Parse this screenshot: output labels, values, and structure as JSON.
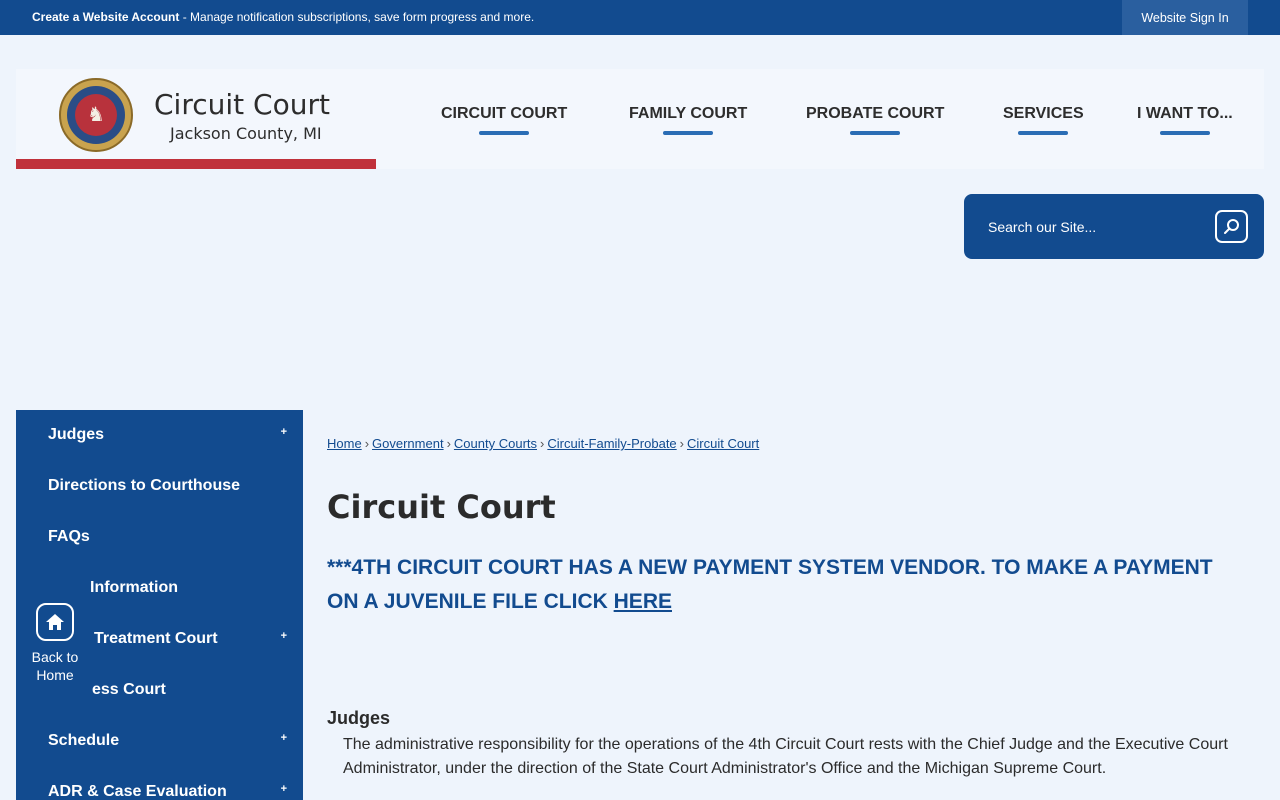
{
  "topbar": {
    "account_link": "Create a Website Account",
    "account_desc": " - Manage notification subscriptions, save form progress and more.",
    "signin": "Website Sign In"
  },
  "header": {
    "site_name": "Circuit Court",
    "site_sub": "Jackson County, MI",
    "nav": [
      {
        "label": "CIRCUIT COURT"
      },
      {
        "label": "FAMILY COURT"
      },
      {
        "label": "PROBATE COURT"
      },
      {
        "label": "SERVICES"
      },
      {
        "label": "I WANT TO..."
      }
    ]
  },
  "search": {
    "placeholder": "Search our Site..."
  },
  "sidebar": {
    "items": [
      {
        "label": "Judges",
        "expand": "+"
      },
      {
        "label": "Directions to Courthouse",
        "expand": ""
      },
      {
        "label": "FAQs",
        "expand": ""
      },
      {
        "label": "Information",
        "expand": ""
      },
      {
        "label": "Treatment Court",
        "expand": "+"
      },
      {
        "label": "ess Court",
        "expand": ""
      },
      {
        "label": "Schedule",
        "expand": "+"
      },
      {
        "label": "ADR & Case Evaluation",
        "expand": "+"
      }
    ],
    "back_home_1": "Back to",
    "back_home_2": "Home"
  },
  "breadcrumbs": [
    "Home",
    "Government",
    "County Courts",
    "Circuit-Family-Probate",
    "Circuit Court"
  ],
  "main": {
    "title": "Circuit Court",
    "alert_text": "***4TH CIRCUIT COURT HAS A NEW PAYMENT SYSTEM VENDOR.  TO MAKE A PAYMENT ON A JUVENILE FILE CLICK ",
    "alert_link": "HERE",
    "section_title": "Judges",
    "section_text": "The administrative responsibility for the operations of the 4th Circuit Court rests with the Chief Judge and the Executive Court Administrator, under the direction of the State Court Administrator's Office and the Michigan Supreme Court."
  },
  "colors": {
    "primary": "#124b8f",
    "accent_red": "#c0313b",
    "nav_underline": "#2a6db5",
    "background": "#eef4fc"
  }
}
